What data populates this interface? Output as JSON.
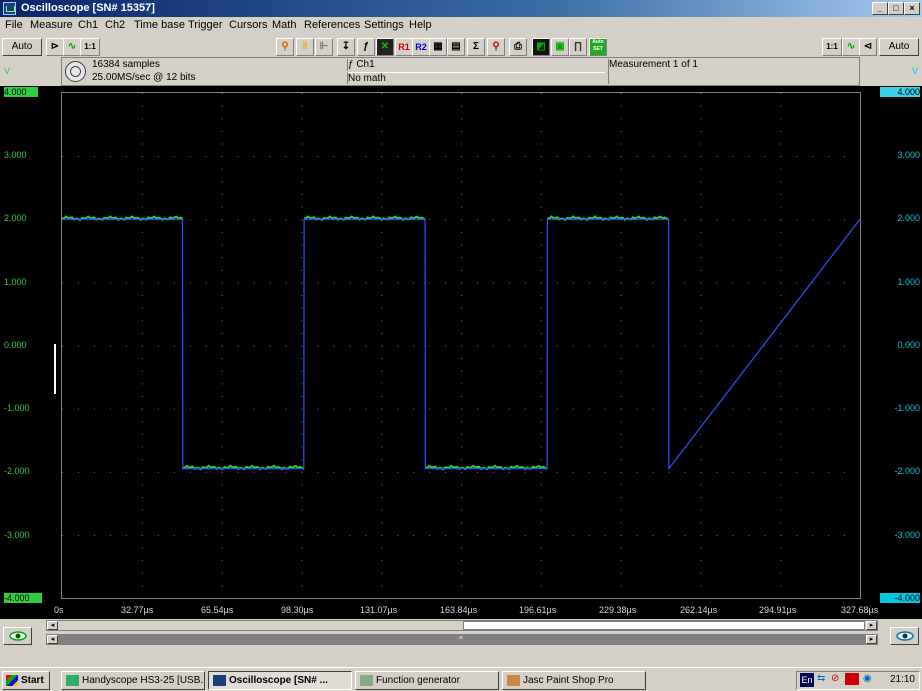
{
  "window": {
    "title": "Oscilloscope  [SN# 15357]",
    "controls": [
      "_",
      "□",
      "×"
    ]
  },
  "menu": [
    "File",
    "Measure",
    "Ch1",
    "Ch2",
    "Time base",
    "Trigger",
    "Cursors",
    "Math",
    "References",
    "Settings",
    "Help"
  ],
  "toolbar": {
    "left_auto": "Auto",
    "right_auto": "Auto",
    "ratio_label": "1:1",
    "ref1": "R1",
    "ref2": "R2",
    "sigma": "Σ",
    "autoset": "Auto SET"
  },
  "info": {
    "samples": "16384 samples",
    "rate": "25.00MS/sec @ 12 bits",
    "channel": "ƒ Ch1",
    "math": "No math",
    "measurement": "Measurement 1 of 1"
  },
  "scale": {
    "unit": "V",
    "left": [
      "4.000",
      "3.000",
      "2.000",
      "1.000",
      "0.000",
      "-1.000",
      "-2.000",
      "-3.000",
      "-4.000"
    ],
    "right": [
      "4.000",
      "3.000",
      "2.000",
      "1.000",
      "0.000",
      "-1.000",
      "-2.000",
      "-3.000",
      "-4.000"
    ]
  },
  "xaxis": [
    "0s",
    "32.77µs",
    "65.54µs",
    "98.30µs",
    "131.07µs",
    "163.84µs",
    "196.61µs",
    "229.38µs",
    "262.14µs",
    "294.91µs",
    "327.68µs"
  ],
  "chart_data": {
    "type": "line",
    "title": "",
    "xlabel": "",
    "ylabel": "V",
    "xlim": [
      0,
      327.68
    ],
    "ylim": [
      -4,
      4
    ],
    "grid": true,
    "series": [
      {
        "color": "#3050ff",
        "x": [
          0,
          49.5,
          49.6,
          99.3,
          99.4,
          149.1,
          149.2,
          199.2,
          199.3,
          249.1,
          249.2,
          327.68
        ],
        "y": [
          2.0,
          2.0,
          -1.95,
          -1.95,
          2.0,
          2.0,
          -1.95,
          -1.95,
          2.0,
          2.0,
          -1.95,
          2.0
        ]
      }
    ]
  },
  "colors": {
    "ch1_trace": "#2ecc40",
    "ch2_trace": "#3050ff",
    "ch1_marker": "#2ecc40",
    "ch2_marker": "#00c8e0"
  },
  "taskbar": {
    "start": "Start",
    "tasks": [
      "Handyscope HS3-25 [USB...",
      "Oscilloscope  [SN# ...",
      "Function generator",
      "Jasc Paint Shop Pro"
    ],
    "tray_lang": "En",
    "clock": "21:10"
  }
}
